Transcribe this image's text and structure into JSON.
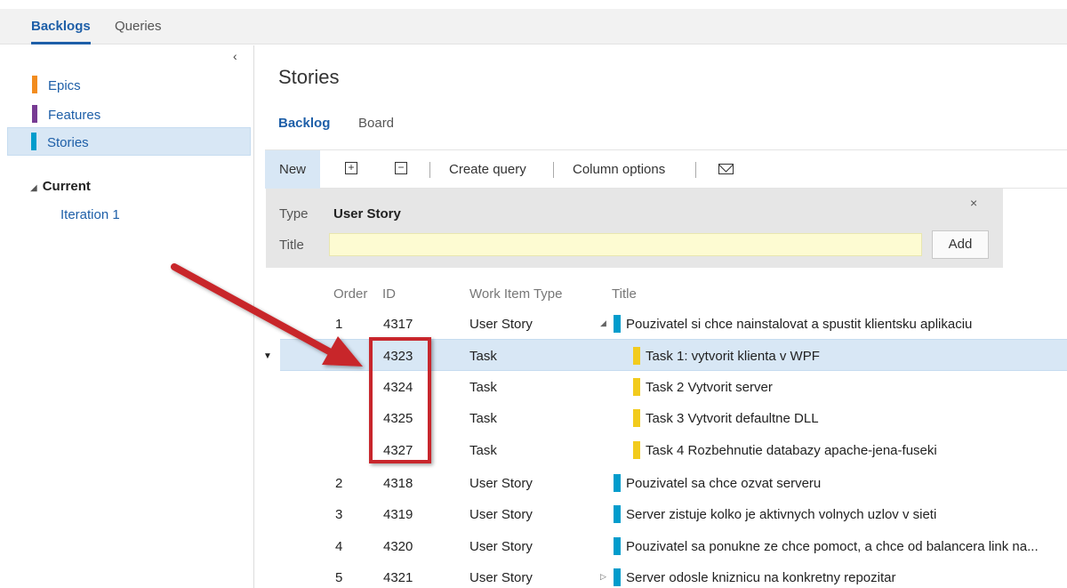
{
  "topnav": {
    "tabs": [
      {
        "label": "Backlogs",
        "active": true
      },
      {
        "label": "Queries",
        "active": false
      }
    ]
  },
  "sidebar": {
    "items": [
      {
        "label": "Epics",
        "color": "#f28c1e",
        "selected": false
      },
      {
        "label": "Features",
        "color": "#773b93",
        "selected": false
      },
      {
        "label": "Stories",
        "color": "#009ccc",
        "selected": true
      }
    ],
    "section_label": "Current",
    "iteration": "Iteration 1"
  },
  "page": {
    "title": "Stories",
    "tabs": [
      {
        "label": "Backlog",
        "active": true
      },
      {
        "label": "Board",
        "active": false
      }
    ]
  },
  "toolbar": {
    "new_label": "New",
    "expand_icon": "plus-box-icon",
    "collapse_icon": "minus-box-icon",
    "create_query_label": "Create query",
    "column_options_label": "Column options",
    "email_icon": "envelope-icon"
  },
  "quick_add": {
    "type_label": "Type",
    "type_value": "User Story",
    "title_label": "Title",
    "title_value": "",
    "add_label": "Add",
    "close_glyph": "×"
  },
  "grid": {
    "columns": {
      "order": "Order",
      "id": "ID",
      "type": "Work Item Type",
      "title": "Title"
    },
    "rows": [
      {
        "order": "1",
        "id": "4317",
        "type": "User Story",
        "title": "Pouzivatel si chce nainstalovat a spustit klientsku aplikaciu",
        "expander": "◢",
        "color": "#009ccc",
        "level": 0,
        "selected": false
      },
      {
        "order": "",
        "id": "4323",
        "type": "Task",
        "title": "Task 1: vytvorit klienta v WPF",
        "expander": "",
        "color": "#f2cb1d",
        "level": 1,
        "selected": true
      },
      {
        "order": "",
        "id": "4324",
        "type": "Task",
        "title": "Task 2 Vytvorit server",
        "expander": "",
        "color": "#f2cb1d",
        "level": 1,
        "selected": false
      },
      {
        "order": "",
        "id": "4325",
        "type": "Task",
        "title": "Task 3 Vytvorit defaultne DLL",
        "expander": "",
        "color": "#f2cb1d",
        "level": 1,
        "selected": false
      },
      {
        "order": "",
        "id": "4327",
        "type": "Task",
        "title": "Task 4 Rozbehnutie databazy apache-jena-fuseki",
        "expander": "",
        "color": "#f2cb1d",
        "level": 1,
        "selected": false
      },
      {
        "order": "2",
        "id": "4318",
        "type": "User Story",
        "title": "Pouzivatel sa chce ozvat serveru",
        "expander": "",
        "color": "#009ccc",
        "level": 0,
        "selected": false
      },
      {
        "order": "3",
        "id": "4319",
        "type": "User Story",
        "title": "Server zistuje kolko je aktivnych volnych uzlov v sieti",
        "expander": "",
        "color": "#009ccc",
        "level": 0,
        "selected": false
      },
      {
        "order": "4",
        "id": "4320",
        "type": "User Story",
        "title": "Pouzivatel sa ponukne ze chce pomoct, a chce od balancera link na...",
        "expander": "",
        "color": "#009ccc",
        "level": 0,
        "selected": false
      },
      {
        "order": "5",
        "id": "4321",
        "type": "User Story",
        "title": "Server odosle kniznicu na konkretny repozitar",
        "expander": "▷",
        "color": "#009ccc",
        "level": 0,
        "selected": false
      }
    ]
  },
  "annotation": {
    "color": "#c8262c"
  }
}
